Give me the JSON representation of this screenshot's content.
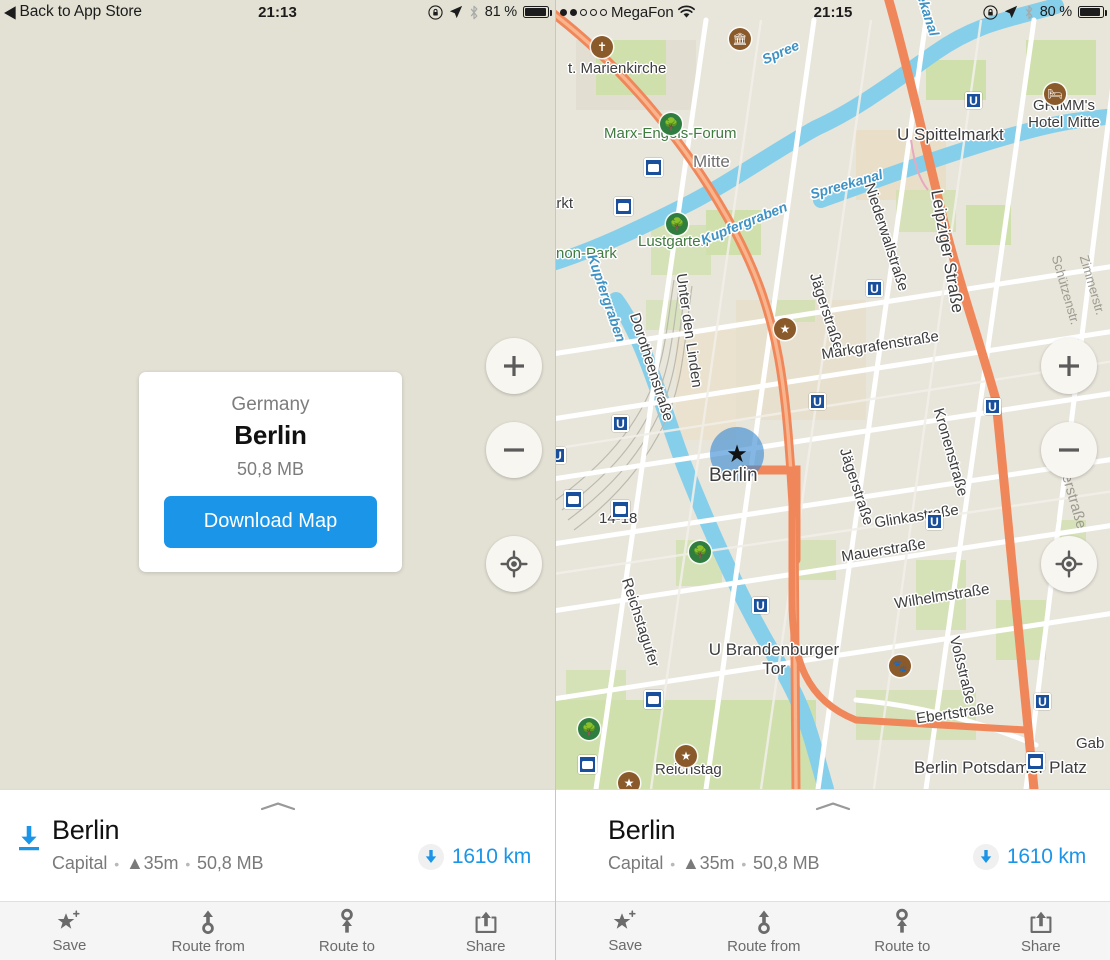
{
  "left": {
    "statusbar": {
      "back_label": "Back to App Store",
      "back_caret": "◀",
      "time": "21:13",
      "battery_pct": "81 %",
      "icons": [
        "rotation-lock-icon",
        "location-arrow-icon",
        "bluetooth-icon",
        "battery-icon"
      ]
    },
    "download_card": {
      "country": "Germany",
      "city": "Berlin",
      "size": "50,8 MB",
      "button_label": "Download Map"
    },
    "sheet": {
      "title": "Berlin",
      "sub_parts": [
        "Capital",
        "▲35m",
        "50,8 MB"
      ],
      "separator": "•",
      "distance": "1610 km",
      "download_icon_visible": true
    },
    "controls": {
      "zoom_in": "+",
      "zoom_out": "−",
      "locate": "locate-icon"
    },
    "toolbar": [
      {
        "label": "Save",
        "icon": "star-plus-icon"
      },
      {
        "label": "Route from",
        "icon": "route-from-icon"
      },
      {
        "label": "Route to",
        "icon": "route-to-icon"
      },
      {
        "label": "Share",
        "icon": "share-icon"
      }
    ]
  },
  "right": {
    "statusbar": {
      "signal_dots": [
        true,
        true,
        false,
        false,
        false
      ],
      "carrier": "MegaFon",
      "wifi": "wifi-icon",
      "time": "21:15",
      "battery_pct": "80 %"
    },
    "sheet": {
      "title": "Berlin",
      "sub_parts": [
        "Capital",
        "▲35m",
        "50,8 MB"
      ],
      "separator": "•",
      "distance": "1610 km",
      "download_icon_visible": false
    },
    "controls": {
      "zoom_in": "+",
      "zoom_out": "−",
      "locate": "locate-icon"
    },
    "toolbar": [
      {
        "label": "Save",
        "icon": "star-plus-icon"
      },
      {
        "label": "Route from",
        "icon": "route-from-icon"
      },
      {
        "label": "Route to",
        "icon": "route-to-icon"
      },
      {
        "label": "Share",
        "icon": "share-icon"
      }
    ],
    "map_labels": {
      "marker_label": "Berlin",
      "places": [
        "Mitte"
      ],
      "pois": [
        "t. Marienkirche",
        "Marx-Engels-Forum",
        "Lustgarten",
        "U Spittelmarkt",
        "GRIMM's Hotel Mitte",
        "Reichstag",
        "U Brandenburger Tor",
        "Berlin Potsdamer Platz",
        "14-18",
        "arkt",
        "non-Park"
      ],
      "waters": [
        "Spree",
        "Spreekanal",
        "Kupfergraben",
        "Kupfergraben"
      ],
      "streets": [
        "Unter den Linden",
        "Dorotheenstraße",
        "Niederwallstraße",
        "Leipziger Straße",
        "Jägerstraße",
        "Markgrafenstraße",
        "Kronenstraße",
        "Jägerstraße",
        "Glinkastraße",
        "Mauerstraße",
        "Wilhelmstraße",
        "Schützenstr.",
        "Zimmerstr.",
        "Zimmerstraße",
        "Voßstraße",
        "Ebertstraße",
        "Reichstagufer",
        "Gab"
      ]
    }
  },
  "colors": {
    "accent_blue": "#1b95e8",
    "map_bg": "#e8e5db",
    "page_bg": "#e3e1d4",
    "road_orange": "#f0875a",
    "water_blue": "#86cfeb",
    "park_green": "#c8dfa8"
  }
}
